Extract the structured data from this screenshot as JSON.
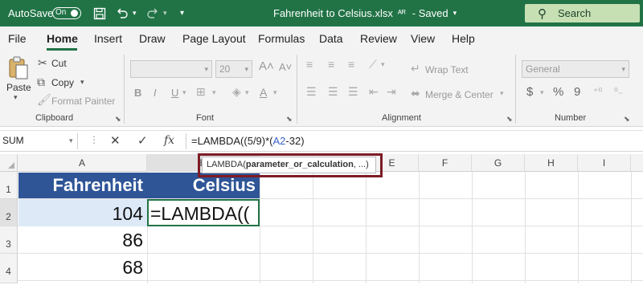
{
  "titlebar": {
    "autosave_label": "AutoSave",
    "toggle_state": "On",
    "doc_title": "Fahrenheit to Celsius.xlsx",
    "status": "Saved",
    "search_placeholder": "Search"
  },
  "menu": {
    "tabs": [
      "File",
      "Home",
      "Insert",
      "Draw",
      "Page Layout",
      "Formulas",
      "Data",
      "Review",
      "View",
      "Help"
    ],
    "active": "Home"
  },
  "ribbon": {
    "clipboard": {
      "label": "Clipboard",
      "paste": "Paste",
      "cut": "Cut",
      "copy": "Copy",
      "format_painter": "Format Painter"
    },
    "font": {
      "label": "Font",
      "font_size": "20",
      "bold": "B",
      "italic": "I",
      "underline": "U"
    },
    "alignment": {
      "label": "Alignment",
      "wrap_text": "Wrap Text",
      "merge_center": "Merge & Center"
    },
    "number": {
      "label": "Number",
      "format": "General",
      "currency": "$",
      "percent": "%",
      "comma": "9"
    }
  },
  "formula_bar": {
    "name_box": "SUM",
    "fx": "fx",
    "formula_prefix": "=LAMBDA((5/9)*(",
    "formula_ref": "A2",
    "formula_suffix": "-32)"
  },
  "tooltip": {
    "func": "LAMBDA(",
    "param": "parameter_or_calculation",
    "rest": ", ...)"
  },
  "grid": {
    "columns": [
      "A",
      "B",
      "C",
      "D",
      "E",
      "F",
      "G",
      "H",
      "I"
    ],
    "rows": [
      "1",
      "2",
      "3",
      "4"
    ],
    "header_a": "Fahrenheit",
    "header_b": "Celsius",
    "a2": "104",
    "b2": "=LAMBDA((",
    "a3": "86",
    "a4": "68"
  },
  "colors": {
    "title_bar": "#217346",
    "table_header": "#2f5597",
    "highlight_box": "#7d1c25"
  }
}
